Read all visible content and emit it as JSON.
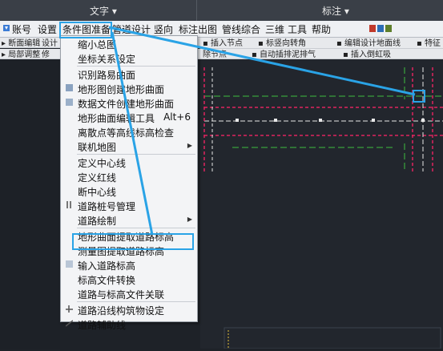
{
  "titlebar": {
    "left_dropdown": "文字",
    "right_dropdown": "标注"
  },
  "menubar": {
    "items": [
      "账号",
      "设置",
      "条件图准备",
      "管道设计",
      "竖向",
      "标注出图",
      "管线综合",
      "三维",
      "工具",
      "帮助"
    ]
  },
  "toolbar_left": [
    "断面编辑",
    "设计",
    "局部调整",
    "修"
  ],
  "toolbar_right_row1": [
    "插入节点",
    "标竖向转角",
    "编辑设计地面线",
    "特征"
  ],
  "toolbar_right_row2": [
    "除节点",
    "自动插排泥排气",
    "插入倒虹吸"
  ],
  "dropdown": {
    "items": [
      {
        "label": "缩小总图"
      },
      {
        "label": "坐标关系设定"
      },
      {
        "label": "识别路易曲面"
      },
      {
        "label": "地形图创建地形曲面"
      },
      {
        "label": "数据文件创建地形曲面"
      },
      {
        "label": "地形曲面编辑工具",
        "shortcut": "Alt+6"
      },
      {
        "label": "离散点等高线标高检查"
      },
      {
        "label": "联机地图",
        "submenu": true
      },
      {
        "label": "定义中心线"
      },
      {
        "label": "定义红线"
      },
      {
        "label": "断中心线"
      },
      {
        "label": "道路桩号管理"
      },
      {
        "label": "道路绘制",
        "submenu": true
      },
      {
        "label": "地形曲面提取道路标高"
      },
      {
        "label": "测量图提取道路标高"
      },
      {
        "label": "输入道路标高"
      },
      {
        "label": "标高文件转换"
      },
      {
        "label": "道路与标高文件关联"
      },
      {
        "label": "道路沿线构筑物设定"
      },
      {
        "label": "道路辅助线"
      }
    ]
  },
  "colors": {
    "highlight": "#2aa3e6",
    "road_red": "#e0245e",
    "road_green": "#3fbf3f",
    "road_white": "#e8e8e8"
  }
}
